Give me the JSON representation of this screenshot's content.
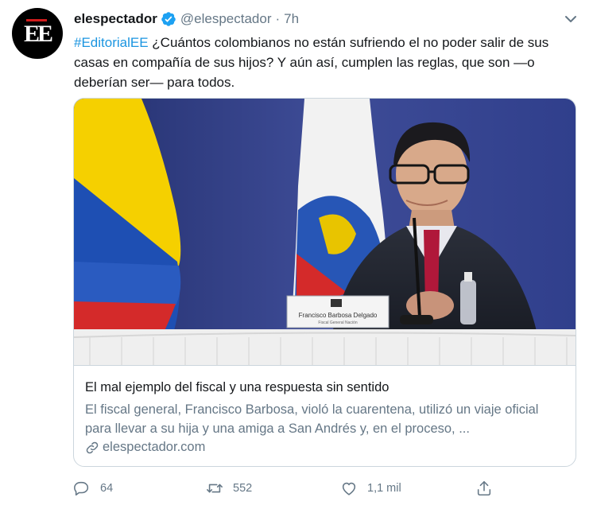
{
  "account": {
    "name": "elespectador",
    "handle": "@elespectador",
    "separator": "·",
    "time": "7h",
    "avatar_text": "EE",
    "brand_red": "#d11c1c"
  },
  "tweet": {
    "hashtag": "#EditorialEE",
    "body": " ¿Cuántos colombianos no están sufriendo el no poder salir de sus casas en compañía de sus hijos? Y aún así, cumplen las reglas, que son —o deberían ser— para todos."
  },
  "card": {
    "title": "El mal ejemplo del fiscal y una respuesta sin sentido",
    "description": "El fiscal general, Francisco Barbosa, violó la cuarentena, utilizó un viaje oficial para llevar a su hija y una amiga a San Andrés y, en el proceso, ...",
    "domain": "elespectador.com",
    "nameplate": "Francisco Barbosa Delgado",
    "nameplate_sub": "Fiscal General Nación"
  },
  "actions": {
    "replies": "64",
    "retweets": "552",
    "likes": "1,1 mil"
  },
  "colors": {
    "link": "#1b95e0",
    "secondary": "#657786",
    "border": "#ccd6dd",
    "verified": "#1da1f2"
  },
  "icons": [
    "verified-badge-icon",
    "chevron-down-icon",
    "link-icon",
    "reply-icon",
    "retweet-icon",
    "like-icon",
    "share-icon"
  ]
}
